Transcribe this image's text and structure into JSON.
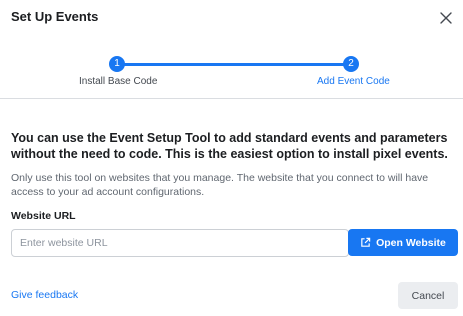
{
  "header": {
    "title": "Set Up Events"
  },
  "stepper": {
    "steps": [
      {
        "number": "1",
        "label": "Install Base Code"
      },
      {
        "number": "2",
        "label": "Add Event Code"
      }
    ]
  },
  "content": {
    "headline": "You can use the Event Setup Tool to add standard events and parameters without the need to code. This is the easiest option to install pixel events.",
    "description": "Only use this tool on websites that you manage. The website that you connect to will have access to your ad account configurations.",
    "url_label": "Website URL",
    "url_placeholder": "Enter website URL",
    "url_value": "",
    "open_button_label": "Open Website"
  },
  "footer": {
    "feedback_label": "Give feedback",
    "cancel_label": "Cancel"
  },
  "colors": {
    "accent": "#1877f2",
    "secondary_button": "#ebedf0",
    "divider": "#dadde1"
  },
  "icons": {
    "close": "close-icon",
    "open_external": "external-link-icon"
  }
}
